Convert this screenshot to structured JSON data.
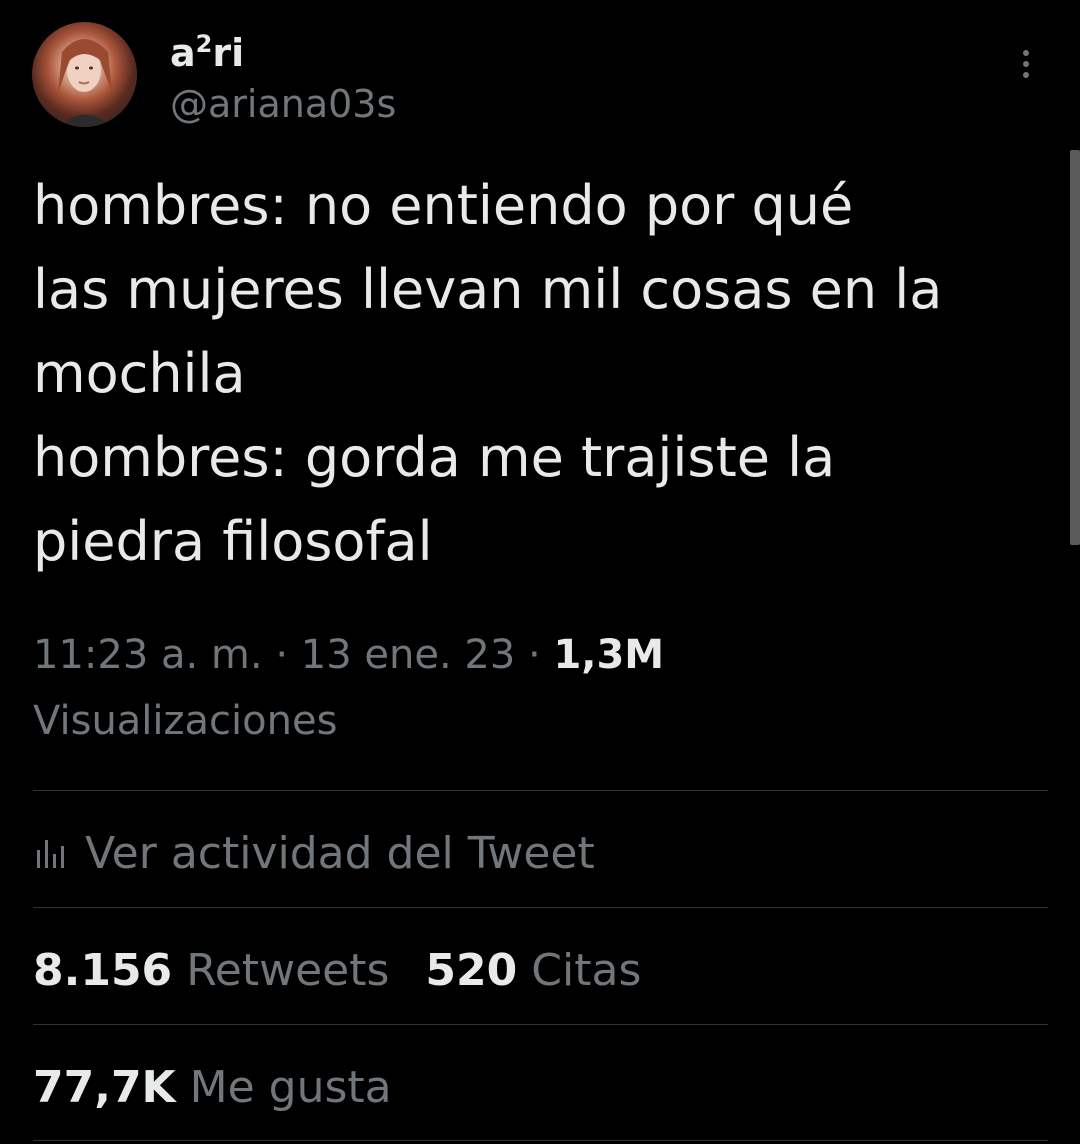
{
  "user": {
    "display_name_base": "a",
    "display_name_sup": "2",
    "display_name_rest": "ri",
    "handle": "@ariana03s"
  },
  "tweet": {
    "text": "hombres: no entiendo por qué\nlas mujeres llevan mil cosas en la\nmochila\nhombres: gorda me trajiste la\npiedra filosofal"
  },
  "meta": {
    "time": "11:23 a. m.",
    "separator": "·",
    "date": "13 ene. 23",
    "views_count": "1,3M",
    "views_label": "Visualizaciones"
  },
  "activity": {
    "label": "Ver actividad del Tweet",
    "icon": "analytics-bars-icon"
  },
  "stats": {
    "retweets_count": "8.156",
    "retweets_label": "Retweets",
    "quotes_count": "520",
    "quotes_label": "Citas",
    "likes_count": "77,7K",
    "likes_label": "Me gusta"
  },
  "icons": {
    "more": "more-vertical-icon",
    "avatar": "profile-photo"
  },
  "colors": {
    "background": "#000000",
    "primary_text": "#e7e9ea",
    "secondary_text": "#71767b",
    "divider": "#2f3336"
  }
}
